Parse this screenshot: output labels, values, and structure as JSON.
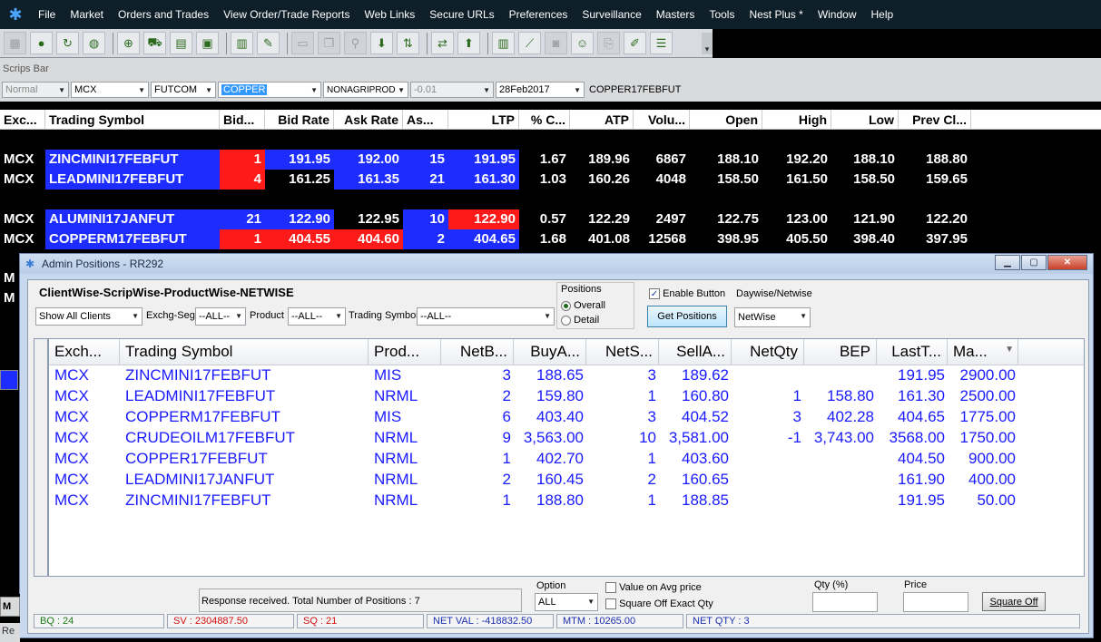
{
  "menu": {
    "items": [
      "File",
      "Market",
      "Orders and Trades",
      "View Order/Trade Reports",
      "Web Links",
      "Secure URLs",
      "Preferences",
      "Surveillance",
      "Masters",
      "Tools",
      "Nest Plus *",
      "Window",
      "Help"
    ]
  },
  "scrips_bar": {
    "label": "Scrips Bar",
    "order_type": "Normal",
    "exchange": "MCX",
    "instrument": "FUTCOM",
    "symbol": "COPPER",
    "series": "NONAGRIPROD",
    "strike": "-0.01",
    "expiry": "28Feb2017",
    "trading_symbol": "COPPER17FEBFUT"
  },
  "market_watch": {
    "columns": [
      "Exc...",
      "Trading Symbol",
      "Bid...",
      "Bid Rate",
      "Ask Rate",
      "As...",
      "LTP",
      "% C...",
      "ATP",
      "Volu...",
      "Open",
      "High",
      "Low",
      "Prev Cl..."
    ],
    "rows": [
      {
        "exc": "MCX",
        "symbol": "ZINCMINI17FEBFUT",
        "bidqty": "1",
        "bid": "191.95",
        "ask": "192.00",
        "askqty": "15",
        "ltp": "191.95",
        "chg": "1.67",
        "atp": "189.96",
        "vol": "6867",
        "open": "188.10",
        "high": "192.20",
        "low": "188.10",
        "prev": "188.80"
      },
      {
        "exc": "MCX",
        "symbol": "LEADMINI17FEBFUT",
        "bidqty": "4",
        "bid": "161.25",
        "ask": "161.35",
        "askqty": "21",
        "ltp": "161.30",
        "chg": "1.03",
        "atp": "160.26",
        "vol": "4048",
        "open": "158.50",
        "high": "161.50",
        "low": "158.50",
        "prev": "159.65"
      },
      {
        "exc": "MCX",
        "symbol": "ALUMINI17JANFUT",
        "bidqty": "21",
        "bid": "122.90",
        "ask": "122.95",
        "askqty": "10",
        "ltp": "122.90",
        "chg": "0.57",
        "atp": "122.29",
        "vol": "2497",
        "open": "122.75",
        "high": "123.00",
        "low": "121.90",
        "prev": "122.20"
      },
      {
        "exc": "MCX",
        "symbol": "COPPERM17FEBFUT",
        "bidqty": "1",
        "bid": "404.55",
        "ask": "404.60",
        "askqty": "2",
        "ltp": "404.65",
        "chg": "1.68",
        "atp": "401.08",
        "vol": "12568",
        "open": "398.95",
        "high": "405.50",
        "low": "398.40",
        "prev": "397.95"
      }
    ],
    "partial_rows": [
      "M",
      "M"
    ]
  },
  "admin_positions": {
    "title": "Admin Positions - RR292",
    "view_title": "ClientWise-ScripWise-ProductWise-NETWISE",
    "clients_filter": "Show All Clients",
    "exchseg_label": "Exchg-Seg",
    "exchseg_value": "--ALL--",
    "product_label": "Product",
    "product_value": "--ALL--",
    "tsym_label": "Trading Symbol",
    "tsym_value": "--ALL--",
    "positions_group_label": "Positions",
    "radio_overall": "Overall",
    "radio_detail": "Detail",
    "enable_button_label": "Enable Button",
    "daywise_label": "Daywise/Netwise",
    "daywise_value": "NetWise",
    "get_positions_label": "Get Positions",
    "columns": [
      "Exch...",
      "Trading Symbol",
      "Prod...",
      "NetB...",
      "BuyA...",
      "NetS...",
      "SellA...",
      "NetQty",
      "BEP",
      "LastT...",
      "Ma..."
    ],
    "rows": [
      {
        "exch": "MCX",
        "symbol": "ZINCMINI17FEBFUT",
        "prod": "MIS",
        "netb": "3",
        "buya": "188.65",
        "nets": "3",
        "sella": "189.62",
        "netqty": "",
        "bep": "",
        "last": "191.95",
        "ma": "2900.00"
      },
      {
        "exch": "MCX",
        "symbol": "LEADMINI17FEBFUT",
        "prod": "NRML",
        "netb": "2",
        "buya": "159.80",
        "nets": "1",
        "sella": "160.80",
        "netqty": "1",
        "bep": "158.80",
        "last": "161.30",
        "ma": "2500.00"
      },
      {
        "exch": "MCX",
        "symbol": "COPPERM17FEBFUT",
        "prod": "MIS",
        "netb": "6",
        "buya": "403.40",
        "nets": "3",
        "sella": "404.52",
        "netqty": "3",
        "bep": "402.28",
        "last": "404.65",
        "ma": "1775.00"
      },
      {
        "exch": "MCX",
        "symbol": "CRUDEOILM17FEBFUT",
        "prod": "NRML",
        "netb": "9",
        "buya": "3,563.00",
        "nets": "10",
        "sella": "3,581.00",
        "netqty": "-1",
        "bep": "3,743.00",
        "last": "3568.00",
        "ma": "1750.00"
      },
      {
        "exch": "MCX",
        "symbol": "COPPER17FEBFUT",
        "prod": "NRML",
        "netb": "1",
        "buya": "402.70",
        "nets": "1",
        "sella": "403.60",
        "netqty": "",
        "bep": "",
        "last": "404.50",
        "ma": "900.00"
      },
      {
        "exch": "MCX",
        "symbol": "LEADMINI17JANFUT",
        "prod": "NRML",
        "netb": "2",
        "buya": "160.45",
        "nets": "2",
        "sella": "160.65",
        "netqty": "",
        "bep": "",
        "last": "161.90",
        "ma": "400.00"
      },
      {
        "exch": "MCX",
        "symbol": "ZINCMINI17FEBFUT",
        "prod": "NRML",
        "netb": "1",
        "buya": "188.80",
        "nets": "1",
        "sella": "188.85",
        "netqty": "",
        "bep": "",
        "last": "191.95",
        "ma": "50.00"
      }
    ],
    "status_message": "Response received. Total Number of Positions : 7",
    "option_label": "Option",
    "option_value": "ALL",
    "value_on_avg_label": "Value on Avg  price",
    "square_off_exact_label": "Square Off Exact Qty",
    "qty_pct_label": "Qty (%)",
    "price_label": "Price",
    "square_off_button": "Square Off",
    "status_bar": {
      "bq": "BQ : 24",
      "sv": "SV : 2304887.50",
      "sq": "SQ : 21",
      "netval": "NET VAL : -418832.50",
      "mtm": "MTM : 10265.00",
      "netqty": "NET QTY : 3"
    }
  },
  "bottom_tabs": {
    "tab1": "M",
    "tab2": "Re"
  }
}
